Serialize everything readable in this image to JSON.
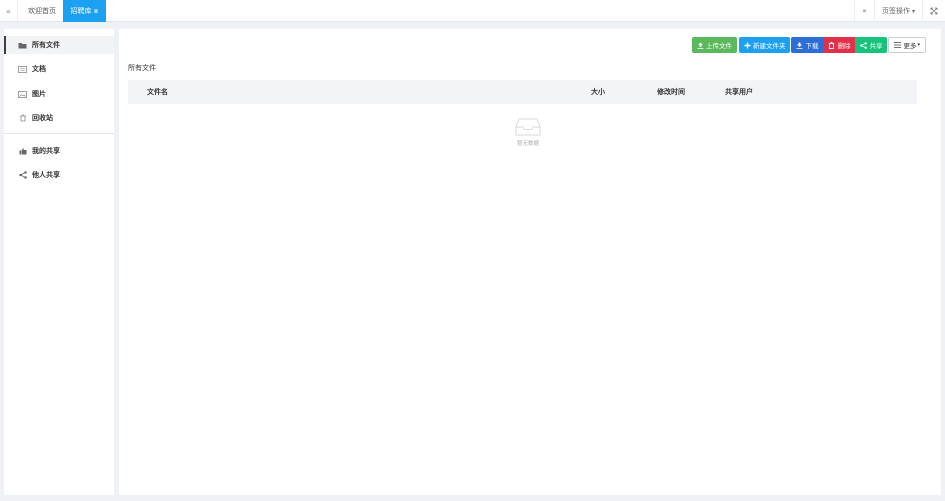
{
  "tabbar": {
    "prev_icon": "double-left-icon",
    "tabs": [
      {
        "label": "欢迎首页"
      },
      {
        "label": "招聘库",
        "close": "⊗"
      }
    ],
    "next_icon": "double-right-icon",
    "page_ops_label": "页签操作",
    "page_ops_caret": "▾",
    "fullscreen_icon": "fullscreen-icon"
  },
  "sidebar": {
    "items": [
      {
        "label": "所有文件",
        "icon": "folder-open-icon"
      },
      {
        "label": "文档",
        "icon": "document-icon"
      },
      {
        "label": "图片",
        "icon": "image-icon"
      },
      {
        "label": "回收站",
        "icon": "trash-icon"
      },
      {
        "label": "我的共享",
        "icon": "thumbs-up-icon"
      },
      {
        "label": "他人共享",
        "icon": "share-icon"
      }
    ]
  },
  "toolbar": {
    "upload_label": "上传文件",
    "new_folder_label": "新建文件夹",
    "download_label": "下载",
    "delete_label": "删除",
    "share_label": "共享",
    "more_label": "更多"
  },
  "breadcrumb": "所有文件",
  "table": {
    "columns": [
      "文件名",
      "大小",
      "修改时间",
      "共享用户"
    ],
    "rows": [],
    "empty_text": "暂无数据"
  },
  "colors": {
    "tab_active": "#1ba0f2",
    "upload": "#5cb85c",
    "new_folder": "#1ba0f2",
    "download": "#2b6ed8",
    "delete": "#e2304b",
    "share": "#17c27a"
  }
}
